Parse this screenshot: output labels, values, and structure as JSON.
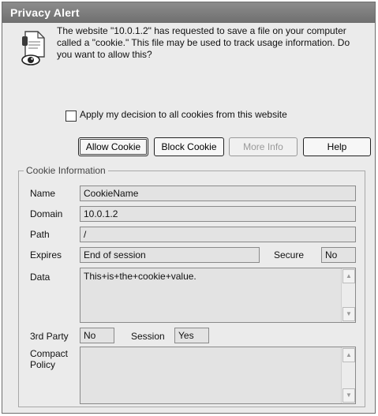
{
  "window": {
    "title": "Privacy Alert"
  },
  "message": "The website \"10.0.1.2\" has requested to save a file on your computer called a \"cookie.\" This file may be used to track usage information. Do you want to allow this?",
  "apply_all": {
    "label": "Apply my decision to all cookies from this website",
    "checked": false
  },
  "buttons": {
    "allow": "Allow Cookie",
    "block": "Block Cookie",
    "more_info": "More Info",
    "help": "Help"
  },
  "cookie_info": {
    "legend": "Cookie Information",
    "name_label": "Name",
    "name_value": "CookieName",
    "domain_label": "Domain",
    "domain_value": "10.0.1.2",
    "path_label": "Path",
    "path_value": "/",
    "expires_label": "Expires",
    "expires_value": "End of session",
    "secure_label": "Secure",
    "secure_value": "No",
    "data_label": "Data",
    "data_value": "This+is+the+cookie+value.",
    "third_party_label": "3rd Party",
    "third_party_value": "No",
    "session_label": "Session",
    "session_value": "Yes",
    "compact_policy_label": "Compact Policy",
    "compact_policy_value": ""
  }
}
